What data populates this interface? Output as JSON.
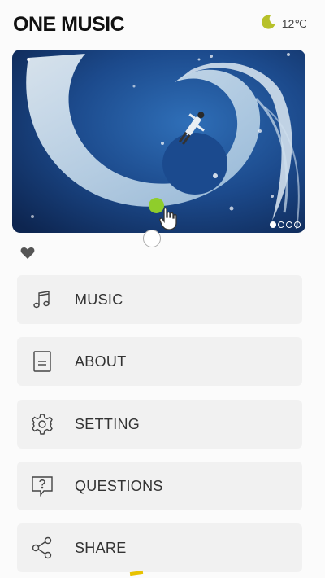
{
  "header": {
    "title": "ONE MUSIC",
    "weather_icon": "moon-icon",
    "temperature": "12℃"
  },
  "banner": {
    "slide_count": 4,
    "active_slide": 1
  },
  "menu": [
    {
      "label": "MUSIC",
      "icon": "music-note-icon"
    },
    {
      "label": "ABOUT",
      "icon": "document-icon"
    },
    {
      "label": "SETTING",
      "icon": "gear-icon"
    },
    {
      "label": "QUESTIONS",
      "icon": "question-bubble-icon"
    },
    {
      "label": "SHARE",
      "icon": "share-icon"
    }
  ],
  "colors": {
    "accent_green": "#8fcd2b",
    "moon": "#b7c12a",
    "card_bg": "#f1f1f1"
  }
}
